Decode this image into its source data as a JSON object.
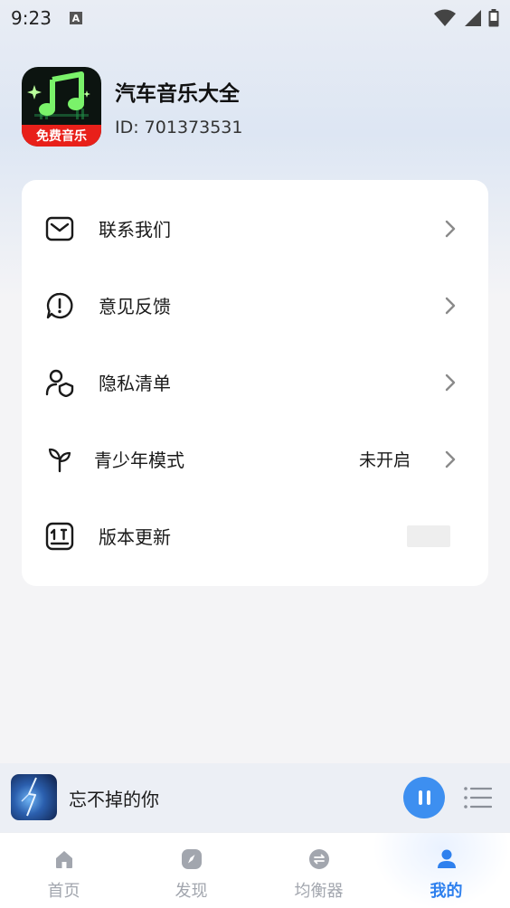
{
  "status_bar": {
    "time": "9:23",
    "notification_letter": "A",
    "icons": [
      "wifi-icon",
      "signal-icon",
      "battery-icon"
    ]
  },
  "app": {
    "name": "汽车音乐大全",
    "id_text": "ID: 701373531",
    "logo_badge": "免费音乐"
  },
  "menu": {
    "items": [
      {
        "label": "联系我们",
        "icon": "mail-icon",
        "value": ""
      },
      {
        "label": "意见反馈",
        "icon": "feedback-icon",
        "value": ""
      },
      {
        "label": "隐私清单",
        "icon": "privacy-icon",
        "value": ""
      },
      {
        "label": "青少年模式",
        "icon": "sprout-icon",
        "value": "未开启"
      },
      {
        "label": "版本更新",
        "icon": "update-icon",
        "value": ""
      }
    ]
  },
  "player": {
    "song_title": "忘不掉的你",
    "state": "playing"
  },
  "tabs": [
    {
      "label": "首页",
      "icon": "home-icon",
      "active": false
    },
    {
      "label": "发现",
      "icon": "compass-icon",
      "active": false
    },
    {
      "label": "均衡器",
      "icon": "equalizer-icon",
      "active": false
    },
    {
      "label": "我的",
      "icon": "profile-icon",
      "active": true
    }
  ],
  "colors": {
    "accent": "#2e80ee",
    "play_button": "#3d8ff0",
    "inactive_tab": "#a2a6ae",
    "logo_badge": "#e8201a"
  }
}
